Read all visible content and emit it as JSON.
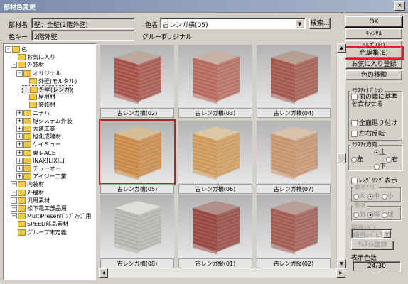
{
  "window": {
    "title": "部材色変更",
    "close_glyph": "×"
  },
  "form": {
    "part_name_label": "部材名",
    "part_name_value": "壁：全壁(2階外壁)",
    "color_key_label": "色キー",
    "color_key_value": "2階外壁",
    "color_name_label": "色名",
    "color_name_value": "古レンガ横(05)",
    "group_label": "グループ",
    "group_value": "オリジナル",
    "search_label": "検索..."
  },
  "buttons": {
    "ok": "OK",
    "cancel": "ｷｬﾝｾﾙ",
    "help": "ﾍﾙﾌﾟ(H)",
    "color_edit": "色編集(E)",
    "favorites_register": "お気に入り登録",
    "color_move": "色の移動"
  },
  "tree": {
    "items": [
      {
        "label": "色",
        "level": 0,
        "expander": "-"
      },
      {
        "label": "お気に入り",
        "level": 1,
        "expander": ""
      },
      {
        "label": "外装材",
        "level": 1,
        "expander": "-"
      },
      {
        "label": "オリジナル",
        "level": 2,
        "expander": "-"
      },
      {
        "label": "外壁(モルタル)",
        "level": 3,
        "expander": ""
      },
      {
        "label": "外壁(レンガ)",
        "level": 3,
        "expander": "",
        "selected": true
      },
      {
        "label": "屋根材",
        "level": 3,
        "expander": ""
      },
      {
        "label": "装飾材",
        "level": 3,
        "expander": ""
      },
      {
        "label": "ニチハ",
        "level": 2,
        "expander": "+"
      },
      {
        "label": "旭システム外装",
        "level": 2,
        "expander": "+"
      },
      {
        "label": "大建工業",
        "level": 2,
        "expander": "+"
      },
      {
        "label": "旭化成建材",
        "level": 2,
        "expander": "+"
      },
      {
        "label": "ケイミュー",
        "level": 2,
        "expander": "+"
      },
      {
        "label": "東レACE",
        "level": 2,
        "expander": "+"
      },
      {
        "label": "INAX[LIXIL]",
        "level": 2,
        "expander": "+"
      },
      {
        "label": "チューオー",
        "level": 2,
        "expander": "+"
      },
      {
        "label": "アイジー工業",
        "level": 2,
        "expander": "+"
      },
      {
        "label": "内装材",
        "level": 1,
        "expander": "+"
      },
      {
        "label": "外構材",
        "level": 1,
        "expander": "+"
      },
      {
        "label": "汎用素材",
        "level": 1,
        "expander": "+"
      },
      {
        "label": "松下電工部品用",
        "level": 1,
        "expander": "+"
      },
      {
        "label": "MultiPresenﾊﾞﾝﾌﾟﾏｯﾌﾟ用",
        "level": 1,
        "expander": "+"
      },
      {
        "label": "SPEED部品素材",
        "level": 1,
        "expander": ""
      },
      {
        "label": "グループ未定義",
        "level": 1,
        "expander": ""
      }
    ]
  },
  "tiles": [
    {
      "label": "古レンガ横(02)",
      "tone": "#a8524a",
      "mortar": "#bba79a",
      "selected": false
    },
    {
      "label": "古レンガ横(03)",
      "tone": "#b86a5e",
      "mortar": "#c8b0a2",
      "selected": false
    },
    {
      "label": "古レンガ横(04)",
      "tone": "#a55a50",
      "mortar": "#b69c8e",
      "selected": false
    },
    {
      "label": "古レンガ横(05)",
      "tone": "#c98a4a",
      "mortar": "#d9be92",
      "selected": true
    },
    {
      "label": "古レンガ横(06)",
      "tone": "#cf9b5c",
      "mortar": "#dfc9a0",
      "selected": false
    },
    {
      "label": "古レンガ横(07)",
      "tone": "#c7956f",
      "mortar": "#dac2a8",
      "selected": false
    },
    {
      "label": "古レンガ横(08)",
      "tone": "#b4b4b0",
      "mortar": "#e2e2dc",
      "selected": false
    },
    {
      "label": "古レンガ縦(01)",
      "tone": "#9a4a44",
      "mortar": "#b08a82",
      "selected": false
    },
    {
      "label": "古レンガ縦(02)",
      "tone": "#a45e56",
      "mortar": "#b89a90",
      "selected": false
    }
  ],
  "texture_options": {
    "title": "ﾃｸｽﾁｬｵﾌﾟｼｮﾝ",
    "fit_edge": "面の端に基準を合わせる",
    "fit_all": "全面貼り付け",
    "flip": "左右反転"
  },
  "texture_direction": {
    "title": "ﾃｸｽﾁｬ方向",
    "up": "上",
    "left": "左",
    "right": "右",
    "down": "下",
    "selected": "up"
  },
  "render_display": {
    "checkbox": "ﾚﾝﾀﾞﾘﾝｸﾞ表示",
    "size_title": "表示ｻｲｽﾞ",
    "size_large": "大",
    "size_medium": "中",
    "size_small": "小",
    "shape_title": "形状",
    "shape_a": "面",
    "shape_b": "箱",
    "shape_c": "球",
    "render_level_title": "描画ﾚﾍﾞﾙ",
    "render_level_value": "描画ﾚﾍﾞﾙ5",
    "thumbnail_register": "ｻﾑﾈｲﾙ登録"
  },
  "count": {
    "label": "表示色数",
    "value": "24/30"
  }
}
